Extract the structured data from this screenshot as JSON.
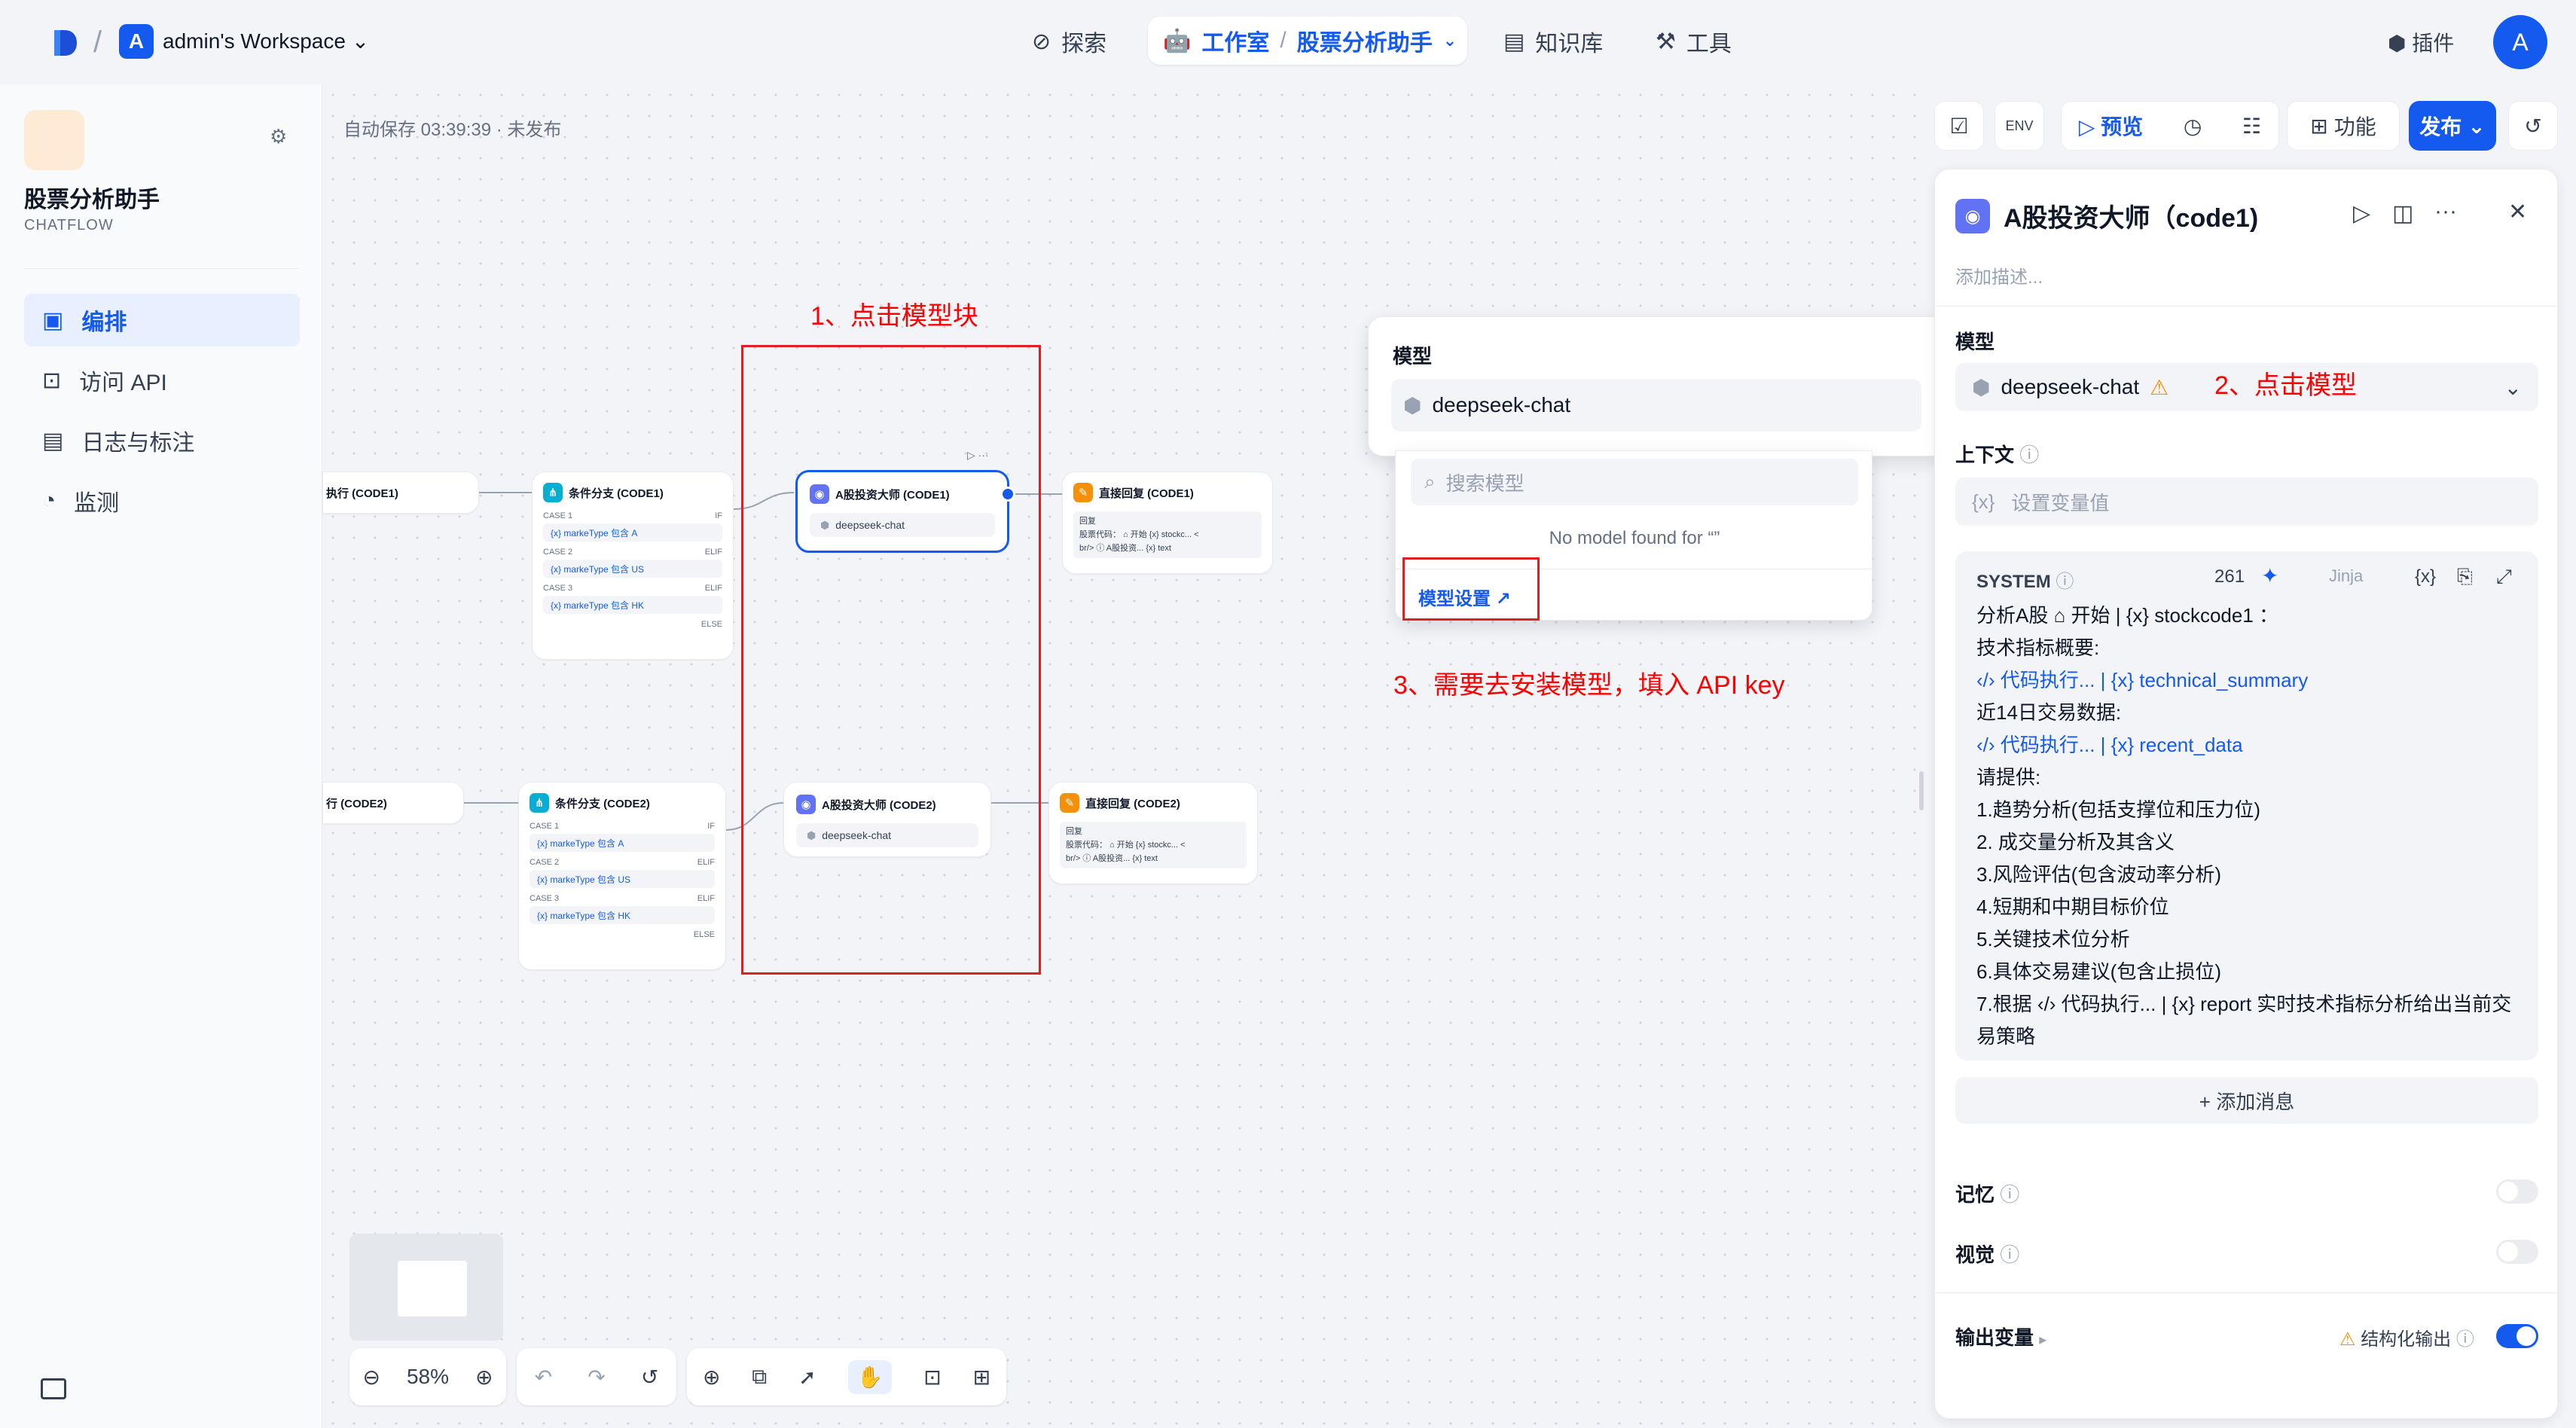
{
  "header": {
    "workspace_initial": "A",
    "workspace_name": "admin's Workspace",
    "nav": {
      "explore": "探索",
      "studio": "工作室",
      "app_name": "股票分析助手",
      "knowledge": "知识库",
      "tools": "工具"
    },
    "plugins": "插件",
    "user_initial": "A"
  },
  "sidebar": {
    "app_name": "股票分析助手",
    "app_type": "CHATFLOW",
    "items": [
      {
        "label": "编排",
        "icon": "layout-icon"
      },
      {
        "label": "访问 API",
        "icon": "terminal-icon"
      },
      {
        "label": "日志与标注",
        "icon": "document-icon"
      },
      {
        "label": "监测",
        "icon": "gauge-icon"
      }
    ]
  },
  "canvas": {
    "autosave": "自动保存 03:39:39 · 未发布",
    "toolbar": {
      "preview": "预览",
      "features": "功能",
      "publish": "发布"
    },
    "zoom": "58%",
    "annotations": {
      "step1": "1、点击模型块",
      "step2": "2、点击模型",
      "step3": "3、需要去安装模型，填入 API key"
    },
    "nodes": {
      "code1_exec": "执行 (CODE1)",
      "code2_exec": "行 (CODE2)",
      "branch1_title": "条件分支 (CODE1)",
      "branch2_title": "条件分支 (CODE2)",
      "case1": "CASE 1",
      "case2": "CASE 2",
      "case3": "CASE 3",
      "if": "IF",
      "elif": "ELIF",
      "else": "ELSE",
      "cond_a": "{x} markeType 包含 A",
      "cond_us": "{x} markeType 包含 US",
      "cond_hk": "{x} markeType 包含 HK",
      "llm1_title": "A股投资大师 (CODE1)",
      "llm2_title": "A股投资大师 (CODE2)",
      "llm_model": "deepseek-chat",
      "reply1_title": "直接回复 (CODE1)",
      "reply2_title": "直接回复 (CODE2)",
      "reply_label": "回复",
      "reply_line1": "股票代码：  ⌂ 开始  {x} stockc...  <",
      "reply_line2": "br/>  ⓘ A股投资...  {x} text"
    }
  },
  "model_popup": {
    "label": "模型",
    "current": "deepseek-chat",
    "search_placeholder": "搜索模型",
    "empty": "No model found for “”",
    "settings_link": "模型设置"
  },
  "panel": {
    "title": "A股投资大师（code1)",
    "desc_placeholder": "添加描述...",
    "model_label": "模型",
    "model_value": "deepseek-chat",
    "context_label": "上下文",
    "context_placeholder": "设置变量值",
    "system_label": "SYSTEM",
    "system_count": "261",
    "jinja": "Jinja",
    "prompt_lines": [
      "分析A股 ⌂ 开始 | {x} stockcode1 ：",
      "技术指标概要:",
      "‹/› 代码执行... | {x} technical_summary",
      "近14日交易数据:",
      "‹/› 代码执行... | {x} recent_data",
      "请提供:",
      "1.趋势分析(包括支撑位和压力位)",
      "2. 成交量分析及其含义",
      "3.风险评估(包含波动率分析)",
      "4.短期和中期目标价位",
      "5.关键技术位分析",
      "6.具体交易建议(包含止损位)",
      "7.根据 ‹/› 代码执行... | {x} report  实时技术指标分析给出当前交",
      "易策略"
    ],
    "add_message": "+ 添加消息",
    "memory": "记忆",
    "vision": "视觉",
    "output_vars": "输出变量",
    "structured_output": "结构化输出",
    "memory_on": false,
    "vision_on": false,
    "structured_on": true
  },
  "colors": {
    "accent": "#155aef",
    "annotation": "#ff0000",
    "warning": "#f79009"
  }
}
